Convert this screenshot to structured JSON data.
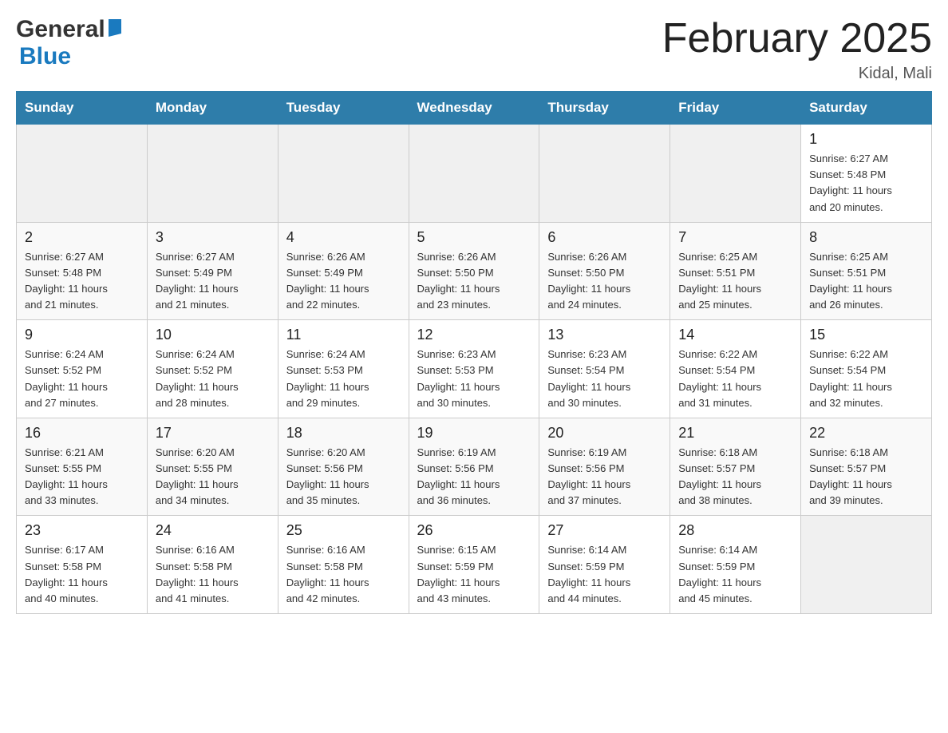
{
  "header": {
    "logo_general": "General",
    "logo_blue": "Blue",
    "month_title": "February 2025",
    "location": "Kidal, Mali"
  },
  "weekdays": [
    "Sunday",
    "Monday",
    "Tuesday",
    "Wednesday",
    "Thursday",
    "Friday",
    "Saturday"
  ],
  "weeks": [
    [
      {
        "day": "",
        "info": ""
      },
      {
        "day": "",
        "info": ""
      },
      {
        "day": "",
        "info": ""
      },
      {
        "day": "",
        "info": ""
      },
      {
        "day": "",
        "info": ""
      },
      {
        "day": "",
        "info": ""
      },
      {
        "day": "1",
        "info": "Sunrise: 6:27 AM\nSunset: 5:48 PM\nDaylight: 11 hours\nand 20 minutes."
      }
    ],
    [
      {
        "day": "2",
        "info": "Sunrise: 6:27 AM\nSunset: 5:48 PM\nDaylight: 11 hours\nand 21 minutes."
      },
      {
        "day": "3",
        "info": "Sunrise: 6:27 AM\nSunset: 5:49 PM\nDaylight: 11 hours\nand 21 minutes."
      },
      {
        "day": "4",
        "info": "Sunrise: 6:26 AM\nSunset: 5:49 PM\nDaylight: 11 hours\nand 22 minutes."
      },
      {
        "day": "5",
        "info": "Sunrise: 6:26 AM\nSunset: 5:50 PM\nDaylight: 11 hours\nand 23 minutes."
      },
      {
        "day": "6",
        "info": "Sunrise: 6:26 AM\nSunset: 5:50 PM\nDaylight: 11 hours\nand 24 minutes."
      },
      {
        "day": "7",
        "info": "Sunrise: 6:25 AM\nSunset: 5:51 PM\nDaylight: 11 hours\nand 25 minutes."
      },
      {
        "day": "8",
        "info": "Sunrise: 6:25 AM\nSunset: 5:51 PM\nDaylight: 11 hours\nand 26 minutes."
      }
    ],
    [
      {
        "day": "9",
        "info": "Sunrise: 6:24 AM\nSunset: 5:52 PM\nDaylight: 11 hours\nand 27 minutes."
      },
      {
        "day": "10",
        "info": "Sunrise: 6:24 AM\nSunset: 5:52 PM\nDaylight: 11 hours\nand 28 minutes."
      },
      {
        "day": "11",
        "info": "Sunrise: 6:24 AM\nSunset: 5:53 PM\nDaylight: 11 hours\nand 29 minutes."
      },
      {
        "day": "12",
        "info": "Sunrise: 6:23 AM\nSunset: 5:53 PM\nDaylight: 11 hours\nand 30 minutes."
      },
      {
        "day": "13",
        "info": "Sunrise: 6:23 AM\nSunset: 5:54 PM\nDaylight: 11 hours\nand 30 minutes."
      },
      {
        "day": "14",
        "info": "Sunrise: 6:22 AM\nSunset: 5:54 PM\nDaylight: 11 hours\nand 31 minutes."
      },
      {
        "day": "15",
        "info": "Sunrise: 6:22 AM\nSunset: 5:54 PM\nDaylight: 11 hours\nand 32 minutes."
      }
    ],
    [
      {
        "day": "16",
        "info": "Sunrise: 6:21 AM\nSunset: 5:55 PM\nDaylight: 11 hours\nand 33 minutes."
      },
      {
        "day": "17",
        "info": "Sunrise: 6:20 AM\nSunset: 5:55 PM\nDaylight: 11 hours\nand 34 minutes."
      },
      {
        "day": "18",
        "info": "Sunrise: 6:20 AM\nSunset: 5:56 PM\nDaylight: 11 hours\nand 35 minutes."
      },
      {
        "day": "19",
        "info": "Sunrise: 6:19 AM\nSunset: 5:56 PM\nDaylight: 11 hours\nand 36 minutes."
      },
      {
        "day": "20",
        "info": "Sunrise: 6:19 AM\nSunset: 5:56 PM\nDaylight: 11 hours\nand 37 minutes."
      },
      {
        "day": "21",
        "info": "Sunrise: 6:18 AM\nSunset: 5:57 PM\nDaylight: 11 hours\nand 38 minutes."
      },
      {
        "day": "22",
        "info": "Sunrise: 6:18 AM\nSunset: 5:57 PM\nDaylight: 11 hours\nand 39 minutes."
      }
    ],
    [
      {
        "day": "23",
        "info": "Sunrise: 6:17 AM\nSunset: 5:58 PM\nDaylight: 11 hours\nand 40 minutes."
      },
      {
        "day": "24",
        "info": "Sunrise: 6:16 AM\nSunset: 5:58 PM\nDaylight: 11 hours\nand 41 minutes."
      },
      {
        "day": "25",
        "info": "Sunrise: 6:16 AM\nSunset: 5:58 PM\nDaylight: 11 hours\nand 42 minutes."
      },
      {
        "day": "26",
        "info": "Sunrise: 6:15 AM\nSunset: 5:59 PM\nDaylight: 11 hours\nand 43 minutes."
      },
      {
        "day": "27",
        "info": "Sunrise: 6:14 AM\nSunset: 5:59 PM\nDaylight: 11 hours\nand 44 minutes."
      },
      {
        "day": "28",
        "info": "Sunrise: 6:14 AM\nSunset: 5:59 PM\nDaylight: 11 hours\nand 45 minutes."
      },
      {
        "day": "",
        "info": ""
      }
    ]
  ]
}
